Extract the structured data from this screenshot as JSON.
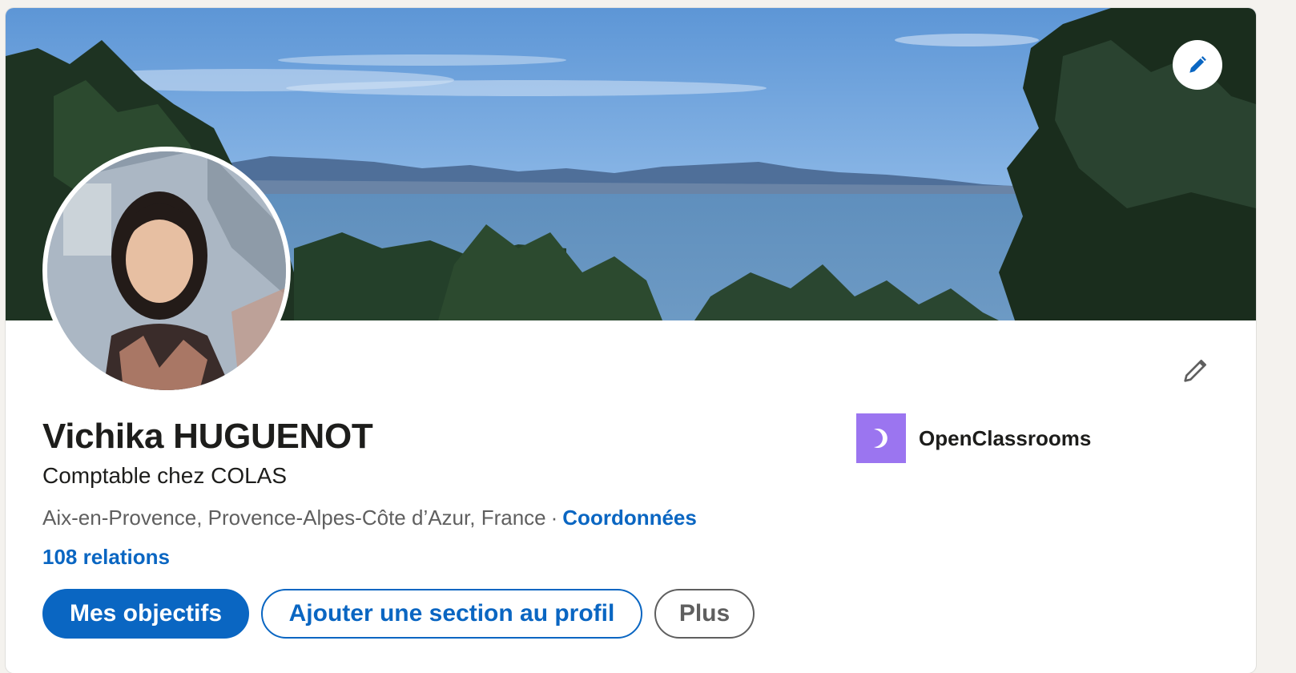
{
  "profile": {
    "name": "Vichika HUGUENOT",
    "headline": "Comptable chez COLAS",
    "location": "Aix-en-Provence, Provence-Alpes-Côte d’Azur, France",
    "separator": "·",
    "contact_link": "Coordonnées",
    "relations": "108 relations"
  },
  "actions": {
    "primary_label": "Mes objectifs",
    "add_section_label": "Ajouter une section au profil",
    "more_label": "Plus"
  },
  "organization": {
    "name": "OpenClassrooms",
    "logo_color": "#9b75f0"
  },
  "icons": {
    "banner_edit": "pencil-icon",
    "profile_edit": "pencil-icon",
    "org_logo": "openclassrooms-logo"
  },
  "colors": {
    "accent": "#0a66c2",
    "text": "#1d1d1b",
    "muted": "#5f5f5f"
  }
}
